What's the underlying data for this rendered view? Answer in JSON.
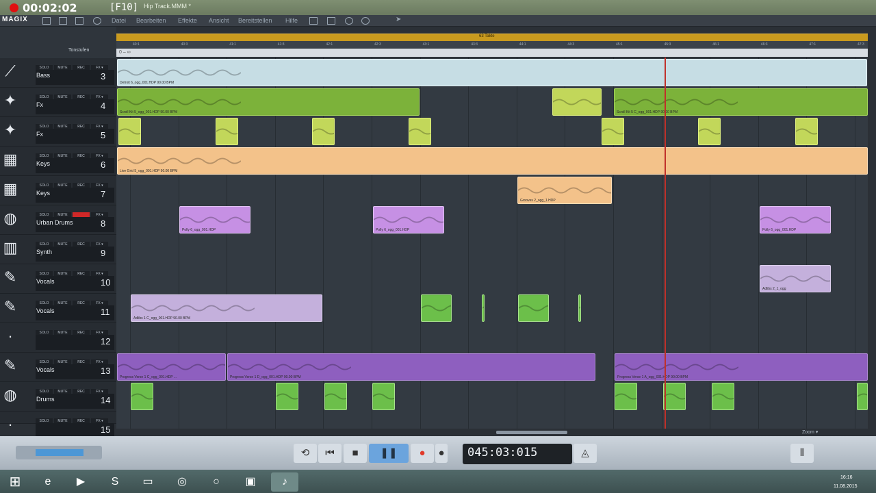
{
  "recording": {
    "time": "00:02:02",
    "key": "[F10]"
  },
  "window": {
    "title": "Hip Track.MMM *"
  },
  "menu": {
    "logo": "MAGIX",
    "items": [
      "Datei",
      "Bearbeiten",
      "Effekte",
      "Ansicht",
      "Bereitstellen",
      "Hilfe"
    ]
  },
  "overview": {
    "label": "63 Takte"
  },
  "header": {
    "tonstufen": "Tonstufen"
  },
  "ruler": {
    "ticks": [
      "40:1",
      "40:3",
      "41:1",
      "41:3",
      "42:1",
      "42:3",
      "43:1",
      "43:3",
      "44:1",
      "44:3",
      "45:1",
      "45:3",
      "46:1",
      "46:3",
      "47:1",
      "47:3"
    ]
  },
  "range": {
    "label": "0 – ∞"
  },
  "track_buttons": {
    "solo": "SOLO",
    "mute": "MUTE",
    "rec": "REC",
    "fx": "FX ▾"
  },
  "tracks": [
    {
      "name": "Bass",
      "num": "3",
      "icon": "guitar-icon"
    },
    {
      "name": "Fx",
      "num": "4",
      "icon": "fx-icon"
    },
    {
      "name": "Fx",
      "num": "5",
      "icon": "fx-icon"
    },
    {
      "name": "Keys",
      "num": "6",
      "icon": "keyboard-icon"
    },
    {
      "name": "Keys",
      "num": "7",
      "icon": "keyboard-icon"
    },
    {
      "name": "Urban Drums",
      "num": "8",
      "icon": "drums-icon"
    },
    {
      "name": "Synth",
      "num": "9",
      "icon": "synth-icon"
    },
    {
      "name": "Vocals",
      "num": "10",
      "icon": "microphone-icon"
    },
    {
      "name": "Vocals",
      "num": "11",
      "icon": "microphone-icon"
    },
    {
      "name": "",
      "num": "12",
      "icon": "empty-icon"
    },
    {
      "name": "Vocals",
      "num": "13",
      "icon": "microphone-icon"
    },
    {
      "name": "Drums",
      "num": "14",
      "icon": "drums-icon"
    },
    {
      "name": "",
      "num": "15",
      "icon": "empty-icon"
    }
  ],
  "clip_names": {
    "bass": "Detroit 6_ogg_001.HDP  90.00 BPM",
    "fx": "Scroll Kit 5_ogg_001.HDP  90.00 BPM",
    "fx2": "Scroll Kit 5 C_ogg_001.HDP  90.00 BPM",
    "keys": "Live Grid 5_ogg_001.HDP  90.00 BPM",
    "keys2": "Grooves 2_ogg_1.HDP",
    "drums8": "Polly 6_ogg_001.HDP",
    "vocals10": "Adlibs 2_1_ogg",
    "vocals11": "Adlibs 1 C_ogg_001.HDP  90.00 BPM",
    "vocals13a": "Progress Verse 1 C_ogg_001.HDP ...",
    "vocals13b": "Progress Verse 1 D_ogg_001.HDP  90.00 BPM",
    "vocals13c": "Progress Verse 1 A_ogg_001.HDP  90.00 BPM"
  },
  "scroll": {
    "zoom": "Zoom ▾"
  },
  "transport": {
    "time": "045:03:015",
    "loop": "⟲",
    "prev": "⏮",
    "stop": "■",
    "pause": "❚❚",
    "record": "●"
  },
  "taskbar": {
    "time": "16:16",
    "date": "11.08.2015"
  },
  "colors": {
    "accent": "#4d97d6",
    "playhead": "#c0302a",
    "recording": "#e01010"
  }
}
